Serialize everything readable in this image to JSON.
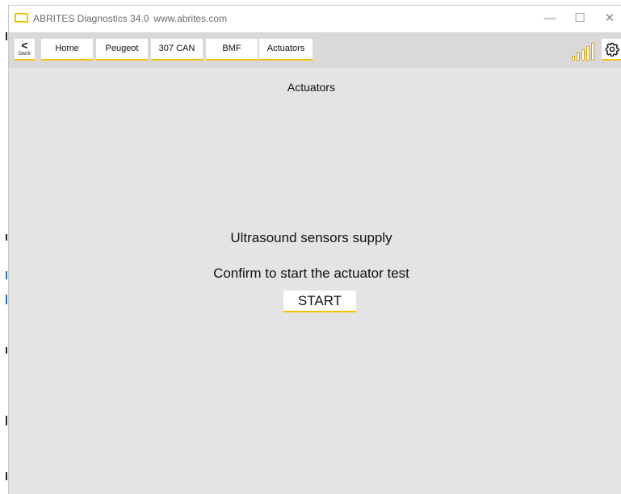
{
  "window": {
    "app_title": "ABRITES Diagnostics 34.0",
    "url": "www.abrites.com",
    "controls": {
      "minimize": "—",
      "maximize": "☐",
      "close": "✕"
    }
  },
  "toolbar": {
    "back_glyph": "<",
    "back_label": "back",
    "breadcrumbs": [
      "Home",
      "Peugeot",
      "307 CAN",
      "BMF",
      "Actuators"
    ],
    "signal_icon": "signal-bars-icon",
    "settings_icon": "gear-icon"
  },
  "main": {
    "title": "Actuators",
    "test_name": "Ultrasound sensors supply",
    "prompt": "Confirm to start the actuator test",
    "start_label": "START"
  },
  "colors": {
    "accent": "#f4c300",
    "background": "#e4e4e4",
    "toolbar": "#d9d9d9"
  }
}
